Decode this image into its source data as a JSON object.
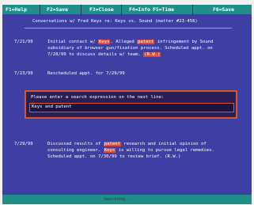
{
  "menu": {
    "items": [
      "F1=Help",
      "F2=Save",
      "F3=Close",
      "F4=Info",
      "F5=Time",
      "F6=Save"
    ]
  },
  "header": {
    "title": "Conversations w/ Fred Keys re: Keys vs. Sound (matter #23-456)"
  },
  "entries": [
    {
      "date": "7/21/99",
      "line1_a": "Initial contact w/ ",
      "line1_hl1": "Keys",
      "line1_b": ". Alleged ",
      "line1_hl2": "patent",
      "line1_c": " infringement by Sound",
      "line2": "subsidiary of browser gun/fixation process. Scheduled appt. on",
      "line3_a": "7/28/99 to discuss details w/ team. ",
      "line3_hl": "(R.W.)"
    },
    {
      "date": "7/23/99",
      "text": "Rescheduled appt. for 7/29/99"
    },
    {
      "date": "7/29/99",
      "line1_a": "Discussed results of ",
      "line1_hl1": "patent",
      "line1_b": " research and initial opinion of",
      "line2_a": "consulting engineer. ",
      "line2_hl": "Keys",
      "line2_b": " is willing to pursue legal remedies.",
      "line3": "Scheduled appt. on 7/30/99 to review brief. (R.W.)"
    }
  ],
  "dialog": {
    "prompt": "Please enter a search expression on the next line:",
    "value": "Keys and patent"
  },
  "status": {
    "text": "Searching..."
  },
  "colors": {
    "screen": "#3d3fa3",
    "bars": "#1f8f8a",
    "highlight": "#d74a3a",
    "dialog_border": "#d8572c"
  }
}
